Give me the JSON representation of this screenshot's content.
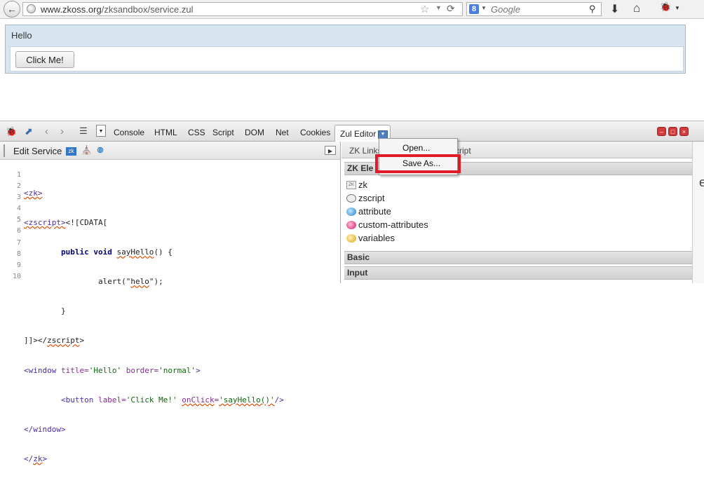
{
  "browser": {
    "url_host": "www.zkoss.org",
    "url_path": "/zksandbox/service.zul",
    "search_engine_icon": "8",
    "search_placeholder": "Google",
    "icons": [
      "back-arrow-icon",
      "globe-icon",
      "star-icon",
      "dropdown-icon",
      "reload-icon",
      "magnifier-icon",
      "download-icon",
      "home-icon",
      "firebug-icon"
    ]
  },
  "page": {
    "window_title": "Hello",
    "button_label": "Click Me!"
  },
  "firebug": {
    "tabs": [
      "Console",
      "HTML",
      "CSS",
      "Script",
      "DOM",
      "Net",
      "Cookies"
    ],
    "active_tab": "Zul Editor",
    "editor_title": "Edit Service",
    "palette_tabs": [
      "ZK Links",
      "cript"
    ],
    "sections": [
      "ZK Ele",
      "Basic",
      "Input"
    ],
    "items": [
      "zk",
      "zscript",
      "attribute",
      "custom-attributes",
      "variables"
    ],
    "menu": [
      "Open...",
      "Save As..."
    ],
    "line_numbers": [
      "1",
      "2",
      "3",
      "4",
      "5",
      "6",
      "7",
      "8",
      "9",
      "10"
    ],
    "code": {
      "l1": "<zk>",
      "l2a": "<zscript>",
      "l2b": "<![CDATA[",
      "l3a": "        public void ",
      "l3b": "sayHello",
      "l3c": "() {",
      "l4a": "                alert(\"",
      "l4b": "helo",
      "l4c": "\");",
      "l5": "        }",
      "l6a": "]]></",
      "l6b": "zscript",
      "l6c": ">",
      "l7a": "<window ",
      "l7b": "title=",
      "l7c": "'Hello' ",
      "l7d": "border=",
      "l7e": "'normal'",
      "l7f": ">",
      "l8a": "        <button ",
      "l8b": "label=",
      "l8c": "'Click Me!' ",
      "l8d": "onClick",
      "l8e": "=",
      "l8f": "'sayHello()'",
      "l8g": "/>",
      "l9": "</window>",
      "l10a": "</",
      "l10b": "zk",
      "l10c": ">"
    },
    "edge_text": "e"
  }
}
